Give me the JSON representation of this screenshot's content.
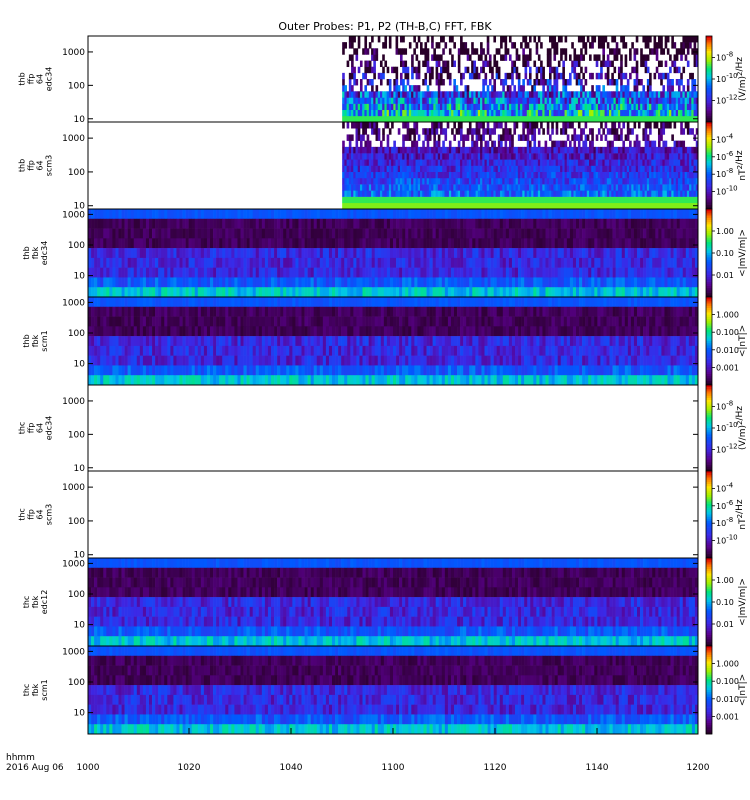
{
  "title": "Outer Probes: P1, P2 (TH-B,C) FFT, FBK",
  "x_axis": {
    "label_lines": [
      "hhmm",
      "2016 Aug 06"
    ],
    "ticks": [
      "1000",
      "1020",
      "1040",
      "1100",
      "1120",
      "1140",
      "1200"
    ]
  },
  "chart_data": [
    {
      "type": "heatmap",
      "name": "thb ffp 64 edc34",
      "label_lines": [
        "thb",
        "ffp",
        "64",
        "edc34"
      ],
      "y_ticks": [
        "10",
        "100",
        "1000"
      ],
      "y_log_range": [
        8,
        3000
      ],
      "data_start_hhmm": "1050",
      "colorbar": {
        "ticks": [
          "10^-8",
          "10^-10",
          "10^-12"
        ],
        "unit": "(V/m)^2/Hz"
      }
    },
    {
      "type": "heatmap",
      "name": "thb ffp 64 scm3",
      "label_lines": [
        "thb",
        "ffp",
        "64",
        "scm3"
      ],
      "y_ticks": [
        "10",
        "100",
        "1000"
      ],
      "y_log_range": [
        8,
        3000
      ],
      "data_start_hhmm": "1050",
      "colorbar": {
        "ticks": [
          "10^-4",
          "10^-6",
          "10^-8",
          "10^-10"
        ],
        "unit": "nT^2/Hz"
      }
    },
    {
      "type": "heatmap",
      "name": "thb fbk edc34",
      "label_lines": [
        "thb",
        "fbk",
        "edc34"
      ],
      "y_ticks": [
        "10",
        "100",
        "1000"
      ],
      "y_log_range": [
        2,
        1500
      ],
      "colorbar": {
        "ticks": [
          "1.00",
          "0.10",
          "0.01"
        ],
        "unit": "<|mV/m|>"
      }
    },
    {
      "type": "heatmap",
      "name": "thb fbk scm1",
      "label_lines": [
        "thb",
        "fbk",
        "scm1"
      ],
      "y_ticks": [
        "10",
        "100",
        "1000"
      ],
      "y_log_range": [
        2,
        1500
      ],
      "colorbar": {
        "ticks": [
          "1.000",
          "0.100",
          "0.010",
          "0.001"
        ],
        "unit": "<|nT|>"
      }
    },
    {
      "type": "heatmap",
      "name": "thc ffp 64 edc34",
      "label_lines": [
        "thc",
        "ffp",
        "64",
        "edc34"
      ],
      "y_ticks": [
        "10",
        "100",
        "1000"
      ],
      "y_log_range": [
        8,
        3000
      ],
      "data_start_hhmm": null,
      "colorbar": {
        "ticks": [
          "10^-8",
          "10^-10",
          "10^-12"
        ],
        "unit": "(V/m)^2/Hz"
      }
    },
    {
      "type": "heatmap",
      "name": "thc ffp 64 scm3",
      "label_lines": [
        "thc",
        "ffp",
        "64",
        "scm3"
      ],
      "y_ticks": [
        "10",
        "100",
        "1000"
      ],
      "y_log_range": [
        8,
        3000
      ],
      "data_start_hhmm": null,
      "colorbar": {
        "ticks": [
          "10^-4",
          "10^-6",
          "10^-8",
          "10^-10"
        ],
        "unit": "nT^2/Hz"
      }
    },
    {
      "type": "heatmap",
      "name": "thc fbk edc12",
      "label_lines": [
        "thc",
        "fbk",
        "edc12"
      ],
      "y_ticks": [
        "10",
        "100",
        "1000"
      ],
      "y_log_range": [
        2,
        1500
      ],
      "colorbar": {
        "ticks": [
          "1.00",
          "0.10",
          "0.01"
        ],
        "unit": "<|mV/m|>"
      }
    },
    {
      "type": "heatmap",
      "name": "thc fbk scm1",
      "label_lines": [
        "thc",
        "fbk",
        "scm1"
      ],
      "y_ticks": [
        "10",
        "100",
        "1000"
      ],
      "y_log_range": [
        2,
        1500
      ],
      "colorbar": {
        "ticks": [
          "1.000",
          "0.100",
          "0.010",
          "0.001"
        ],
        "unit": "<|nT|>"
      }
    }
  ]
}
